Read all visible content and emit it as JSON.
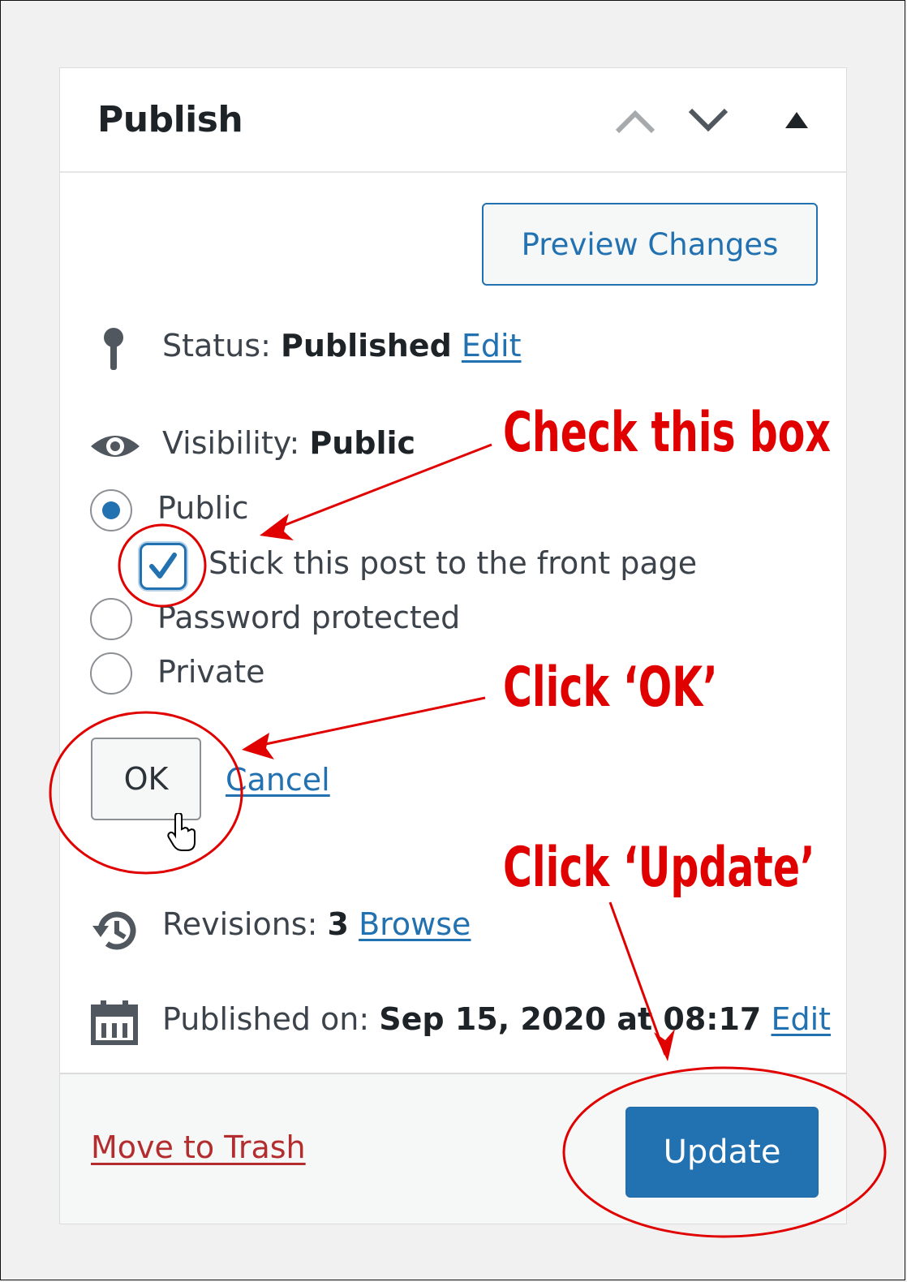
{
  "panel": {
    "title": "Publish",
    "header_icons": [
      "chevron-up-icon",
      "chevron-down-icon",
      "triangle-up-icon"
    ]
  },
  "preview_button": "Preview Changes",
  "status": {
    "label": "Status:",
    "value": "Published",
    "edit": "Edit",
    "icon": "pin-icon"
  },
  "visibility": {
    "label": "Visibility:",
    "value": "Public",
    "icon": "eye-icon",
    "options": [
      {
        "label": "Public",
        "selected": true
      },
      {
        "label": "Password protected",
        "selected": false
      },
      {
        "label": "Private",
        "selected": false
      }
    ],
    "sticky_label": "Stick this post to the front page",
    "sticky_checked": true,
    "ok": "OK",
    "cancel": "Cancel"
  },
  "revisions": {
    "label": "Revisions:",
    "value": "3",
    "link": "Browse",
    "icon": "history-icon"
  },
  "published": {
    "label": "Published on:",
    "value": "Sep 15, 2020 at 08:17",
    "edit": "Edit",
    "icon": "calendar-icon"
  },
  "footer": {
    "trash": "Move to Trash",
    "update": "Update"
  },
  "annotations": {
    "check": "Check this box",
    "ok": "Click ‘OK’",
    "update": "Click ‘Update’",
    "color": "#e00000"
  },
  "colors": {
    "link": "#2271b1",
    "primary": "#2271b1",
    "danger": "#b32d2e"
  }
}
